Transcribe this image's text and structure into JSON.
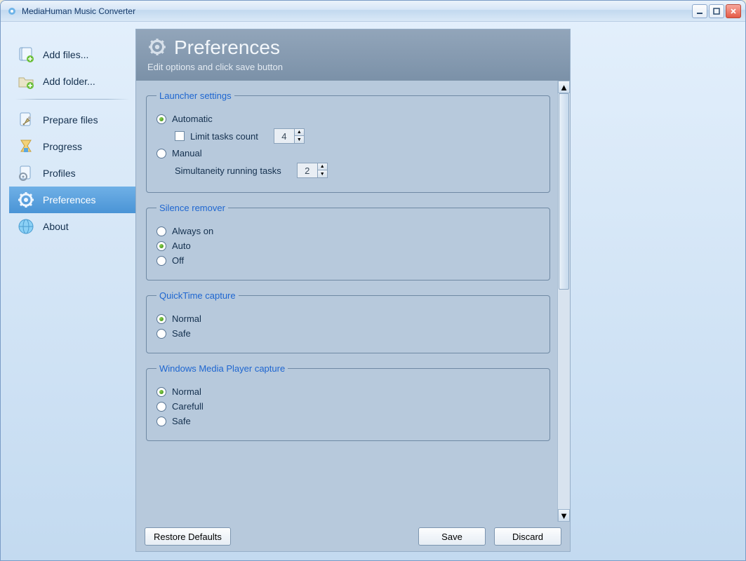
{
  "window": {
    "title": "MediaHuman Music Converter"
  },
  "sidebar": {
    "items": [
      {
        "label": "Add files...",
        "icon": "add-files"
      },
      {
        "label": "Add folder...",
        "icon": "add-folder"
      },
      {
        "label": "Prepare files",
        "icon": "prepare"
      },
      {
        "label": "Progress",
        "icon": "progress"
      },
      {
        "label": "Profiles",
        "icon": "profiles"
      },
      {
        "label": "Preferences",
        "icon": "preferences"
      },
      {
        "label": "About",
        "icon": "about"
      }
    ],
    "selected_index": 5
  },
  "header": {
    "title": "Preferences",
    "subtitle": "Edit options and click save button"
  },
  "groups": {
    "launcher": {
      "legend": "Launcher settings",
      "automatic_label": "Automatic",
      "limit_tasks_label": "Limit tasks count",
      "limit_tasks_value": "4",
      "manual_label": "Manual",
      "simul_label": "Simultaneity running tasks",
      "simul_value": "2",
      "selected": "automatic",
      "limit_checked": false
    },
    "silence": {
      "legend": "Silence remover",
      "options": [
        "Always on",
        "Auto",
        "Off"
      ],
      "selected_index": 1
    },
    "quicktime": {
      "legend": "QuickTime capture",
      "options": [
        "Normal",
        "Safe"
      ],
      "selected_index": 0
    },
    "wmp": {
      "legend": "Windows Media Player capture",
      "options": [
        "Normal",
        "Carefull",
        "Safe"
      ],
      "selected_index": 0
    }
  },
  "buttons": {
    "restore": "Restore Defaults",
    "save": "Save",
    "discard": "Discard"
  }
}
